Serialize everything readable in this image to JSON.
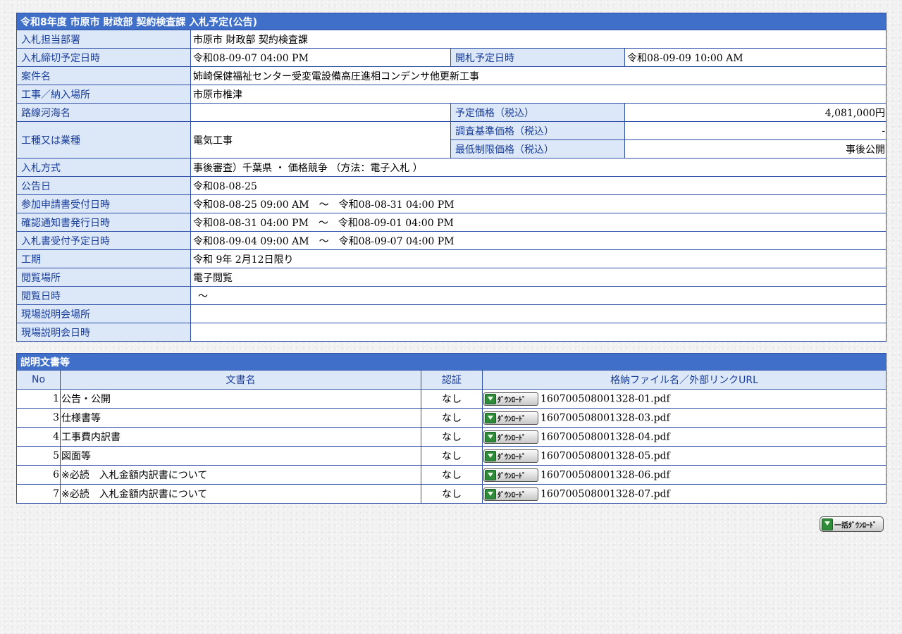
{
  "info": {
    "caption": "令和8年度 市原市 財政部 契約検査課 入札予定(公告)",
    "rows": {
      "dept": {
        "label": "入札担当部署",
        "value": "市原市 財政部 契約検査課"
      },
      "deadline": {
        "label": "入札締切予定日時",
        "value": "令和08-09-07 04:00 PM"
      },
      "opening": {
        "label": "開札予定日時",
        "value": "令和08-09-09 10:00 AM"
      },
      "title": {
        "label": "案件名",
        "value": "姉崎保健福祉センター受変電設備高圧進相コンデンサ他更新工事"
      },
      "location": {
        "label": "工事／納入場所",
        "value": "市原市椎津"
      },
      "route": {
        "label": "路線河海名",
        "value": ""
      },
      "planned_price": {
        "label": "予定価格（税込）",
        "value": "4,081,000円"
      },
      "category": {
        "label": "工種又は業種",
        "value": "電気工事"
      },
      "survey_price": {
        "label": "調査基準価格（税込）",
        "value": "-"
      },
      "min_price": {
        "label": "最低制限価格（税込）",
        "value": "事後公開"
      },
      "method": {
        "label": "入札方式",
        "value": "事後審査）千葉県 ・ 価格競争 （方法：電子入札 ）"
      },
      "announce_date": {
        "label": "公告日",
        "value": "令和08-08-25"
      },
      "application": {
        "label": "参加申請書受付日時",
        "value": "令和08-08-25 09:00 AM　～　令和08-08-31 04:00 PM"
      },
      "confirmation": {
        "label": "確認通知書発行日時",
        "value": "令和08-08-31 04:00 PM　～　令和08-09-01 04:00 PM"
      },
      "bid_receipt": {
        "label": "入札書受付予定日時",
        "value": "令和08-09-04 09:00 AM　～　令和08-09-07 04:00 PM"
      },
      "period": {
        "label": "工期",
        "value": "令和 9年 2月12日限り"
      },
      "view_place": {
        "label": "閲覧場所",
        "value": "電子閲覧"
      },
      "view_date": {
        "label": "閲覧日時",
        "value": "～"
      },
      "briefing_place": {
        "label": "現場説明会場所",
        "value": ""
      },
      "briefing_date": {
        "label": "現場説明会日時",
        "value": ""
      }
    }
  },
  "docs": {
    "caption": "説明文書等",
    "headers": {
      "no": "No",
      "name": "文書名",
      "auth": "認証",
      "file": "格納ファイル名／外部リンクURL"
    },
    "download_label": "ﾀﾞｳﾝﾛｰﾄﾞ",
    "rows": [
      {
        "no": "1",
        "name": "公告・公開",
        "auth": "なし",
        "file": "160700508001328-01.pdf"
      },
      {
        "no": "3",
        "name": "仕様書等",
        "auth": "なし",
        "file": "160700508001328-03.pdf"
      },
      {
        "no": "4",
        "name": "工事費内訳書",
        "auth": "なし",
        "file": "160700508001328-04.pdf"
      },
      {
        "no": "5",
        "name": "図面等",
        "auth": "なし",
        "file": "160700508001328-05.pdf"
      },
      {
        "no": "6",
        "name": "※必読　入札金額内訳書について",
        "auth": "なし",
        "file": "160700508001328-06.pdf"
      },
      {
        "no": "7",
        "name": "※必読　入札金額内訳書について",
        "auth": "なし",
        "file": "160700508001328-07.pdf"
      }
    ]
  },
  "bulk_download_label": "一括ﾀﾞｳﾝﾛｰﾄﾞ",
  "icons": {
    "download": "download-icon"
  },
  "colors": {
    "caption_bg": "#3f6fc9",
    "label_bg": "#dce8f7",
    "label_text": "#1a3e9a",
    "border": "#2d4fa8"
  }
}
